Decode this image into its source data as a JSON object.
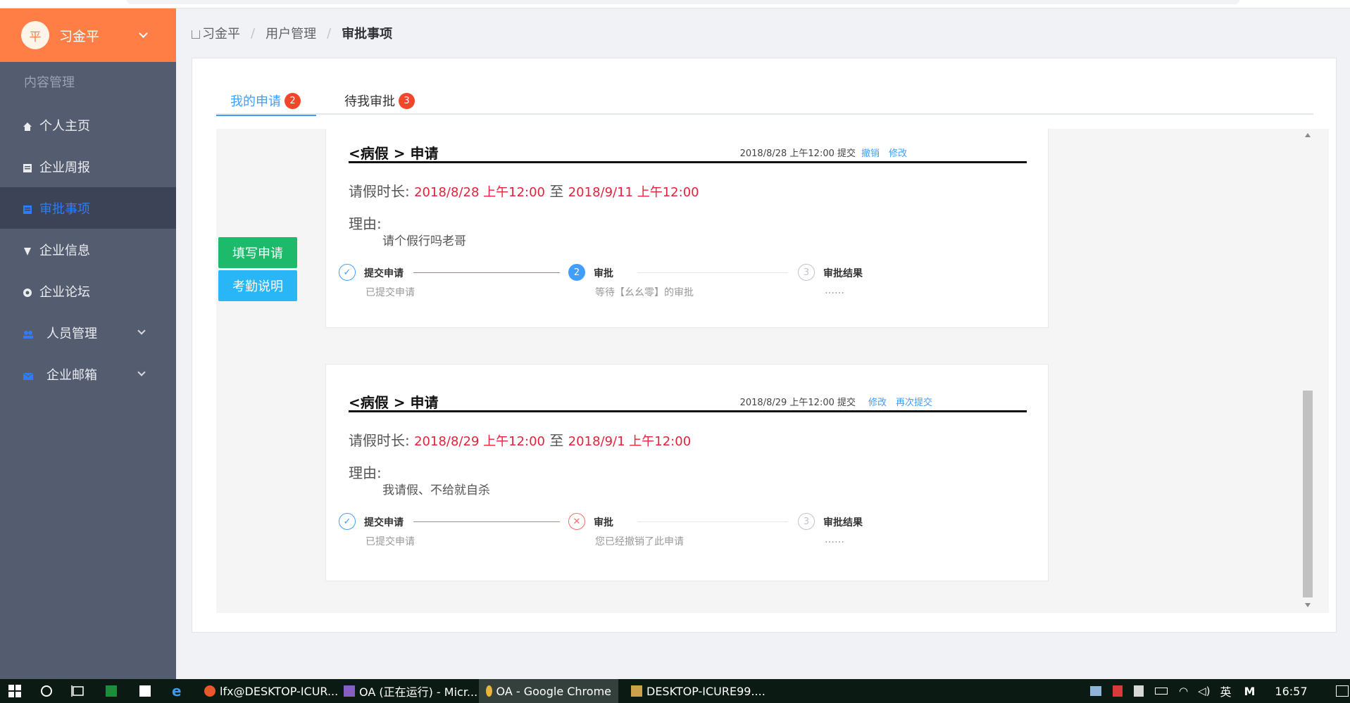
{
  "user": {
    "avatar_char": "平",
    "name": "习金平"
  },
  "sidebar": {
    "section_label": "内容管理",
    "items": [
      {
        "label": "个人主页",
        "icon": "home-icon"
      },
      {
        "label": "企业周报",
        "icon": "report-icon"
      },
      {
        "label": "审批事项",
        "icon": "approval-icon",
        "active": true
      },
      {
        "label": "企业信息",
        "icon": "info-icon"
      },
      {
        "label": "企业论坛",
        "icon": "forum-icon"
      },
      {
        "label": "人员管理",
        "icon": "people-icon",
        "expandable": true
      },
      {
        "label": "企业邮箱",
        "icon": "mail-icon",
        "expandable": true
      }
    ]
  },
  "breadcrumb": {
    "home": "习金平",
    "parent": "用户管理",
    "current": "审批事项"
  },
  "tabs": [
    {
      "label": "我的申请",
      "badge": "2",
      "active": true
    },
    {
      "label": "待我审批",
      "badge": "3"
    }
  ],
  "actions": {
    "fill": "填写申请",
    "explain": "考勤说明"
  },
  "applications": [
    {
      "title": "<病假 > 申请",
      "submitted": "2018/8/28 上午12:00 提交",
      "links": [
        "撤销",
        "修改"
      ],
      "duration_label": "请假时长: ",
      "start": "2018/8/28 上午12:00",
      "to": " 至 ",
      "end": "2018/9/11 上午12:00",
      "reason_label": "理由:",
      "reason": "请个假行吗老哥",
      "steps": [
        {
          "title": "提交申请",
          "desc": "已提交申请",
          "status": "done"
        },
        {
          "title": "审批",
          "desc": "等待【幺幺零】的审批",
          "status": "process",
          "num": "2"
        },
        {
          "title": "审批结果",
          "desc": "……",
          "status": "wait",
          "num": "3"
        }
      ]
    },
    {
      "title": "<病假 > 申请",
      "submitted": "2018/8/29 上午12:00 提交",
      "links": [
        "修改",
        "再次提交"
      ],
      "duration_label": "请假时长: ",
      "start": "2018/8/29 上午12:00",
      "to": " 至 ",
      "end": "2018/9/1 上午12:00",
      "reason_label": "理由:",
      "reason": "我请假、不给就自杀",
      "steps": [
        {
          "title": "提交申请",
          "desc": "已提交申请",
          "status": "done"
        },
        {
          "title": "审批",
          "desc": "您已经撤销了此申请",
          "status": "error"
        },
        {
          "title": "审批结果",
          "desc": "……",
          "status": "wait",
          "num": "3"
        }
      ]
    }
  ],
  "taskbar": {
    "items": [
      {
        "label": "lfx@DESKTOP-ICUR..."
      },
      {
        "label": "OA (正在运行) - Micr..."
      },
      {
        "label": "OA - Google Chrome",
        "active": true
      },
      {
        "label": "DESKTOP-ICURE99...."
      }
    ],
    "ime": "英",
    "ime_mode": "M",
    "time": "16:57"
  },
  "colors": {
    "accent": "#409eff",
    "brand": "#ff7e45",
    "sidebar": "#545c70",
    "danger": "#e6213b"
  }
}
